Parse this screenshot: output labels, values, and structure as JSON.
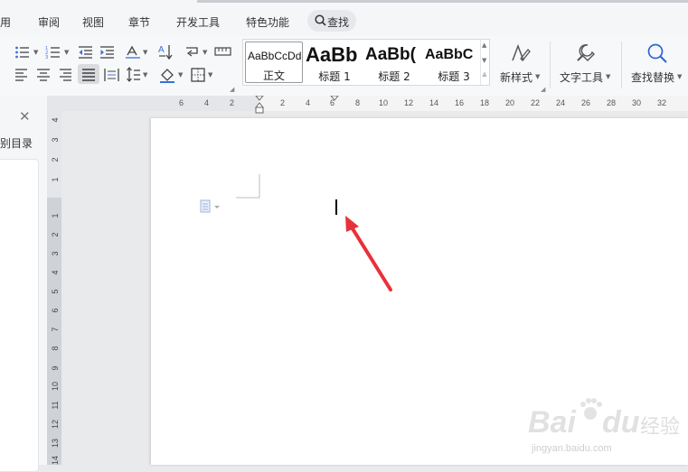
{
  "menu": {
    "items": [
      {
        "label": "引用",
        "visible": "用"
      },
      {
        "label": "审阅"
      },
      {
        "label": "视图"
      },
      {
        "label": "章节"
      },
      {
        "label": "开发工具"
      },
      {
        "label": "特色功能"
      }
    ],
    "search_label": "查找"
  },
  "toolbar": {
    "styles": [
      {
        "sample": "AaBbCcDd",
        "name": "正文"
      },
      {
        "sample": "AaBb",
        "name": "标题 1"
      },
      {
        "sample": "AaBb(",
        "name": "标题 2"
      },
      {
        "sample": "AaBbC",
        "name": "标题 3"
      }
    ],
    "new_style_label": "新样式",
    "text_tools_label": "文字工具",
    "find_replace_label": "查找替换"
  },
  "nav_panel": {
    "title_fragment": "别目录"
  },
  "ruler_top": [
    "6",
    "4",
    "2",
    "2",
    "4",
    "6",
    "8",
    "10",
    "12",
    "14",
    "16",
    "18",
    "20",
    "22",
    "24",
    "26",
    "28",
    "30",
    "32"
  ],
  "ruler_left": [
    "4",
    "3",
    "2",
    "1",
    "1",
    "2",
    "3",
    "4",
    "5",
    "6",
    "7",
    "8",
    "9",
    "10",
    "11",
    "12",
    "13",
    "14"
  ],
  "watermark": {
    "brand": "Bai",
    "brand2": "du",
    "service": "经验",
    "url": "jingyan.baidu.com"
  },
  "colors": {
    "arrow": "#e8313a",
    "accent": "#2b64d8"
  }
}
